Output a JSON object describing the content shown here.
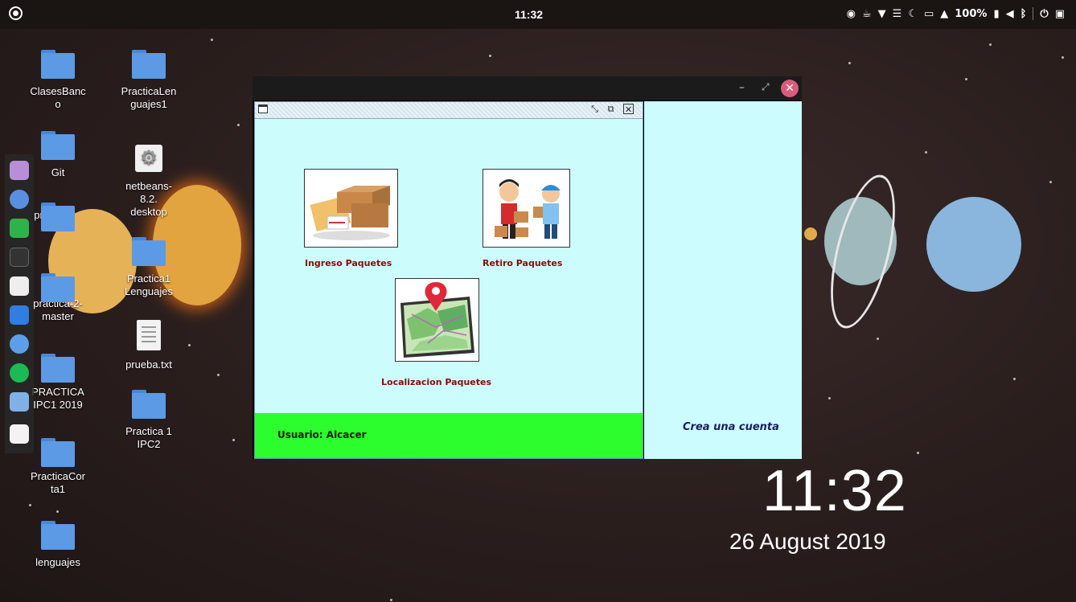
{
  "topbar": {
    "clock": "11:32",
    "battery": "100%"
  },
  "desktop": {
    "icons": [
      {
        "label": "ClasesBanc\no"
      },
      {
        "label": "Git"
      },
      {
        "label": "practica"
      },
      {
        "label": "practica-2-\nmaster"
      },
      {
        "label": "PRACTICA\nIPC1 2019"
      },
      {
        "label": "PracticaCor\nta1"
      },
      {
        "label": "lenguajes"
      },
      {
        "label": "PracticaLen\nguajes1"
      },
      {
        "label": "netbeans-\n8.2.\ndesktop"
      },
      {
        "label": "Practica1\nLenguajes"
      },
      {
        "label": "prueba.txt"
      },
      {
        "label": "Practica 1\nIPC2"
      }
    ],
    "big_clock": "11:32",
    "big_date": "26 August 2019"
  },
  "window": {
    "buttons": {
      "minimize": "–",
      "maximize": "⤢",
      "close": "✕"
    },
    "internal_frame": {
      "items": [
        {
          "label": "Ingreso Paquetes",
          "icon": "packages-icon"
        },
        {
          "label": "Retiro Paquetes",
          "icon": "delivery-people-icon"
        },
        {
          "label": "Localizacion Paquetes",
          "icon": "map-pin-icon"
        }
      ],
      "user_label": "Usuario: Alcacer"
    },
    "side_panel": {
      "link": "Crea una cuenta"
    }
  },
  "colors": {
    "left_panel": "#cdfcfd",
    "user_bar": "#2cfd2c",
    "label_red": "#8b0a0a",
    "link_navy": "#152060",
    "close_button": "#d85c7e"
  }
}
